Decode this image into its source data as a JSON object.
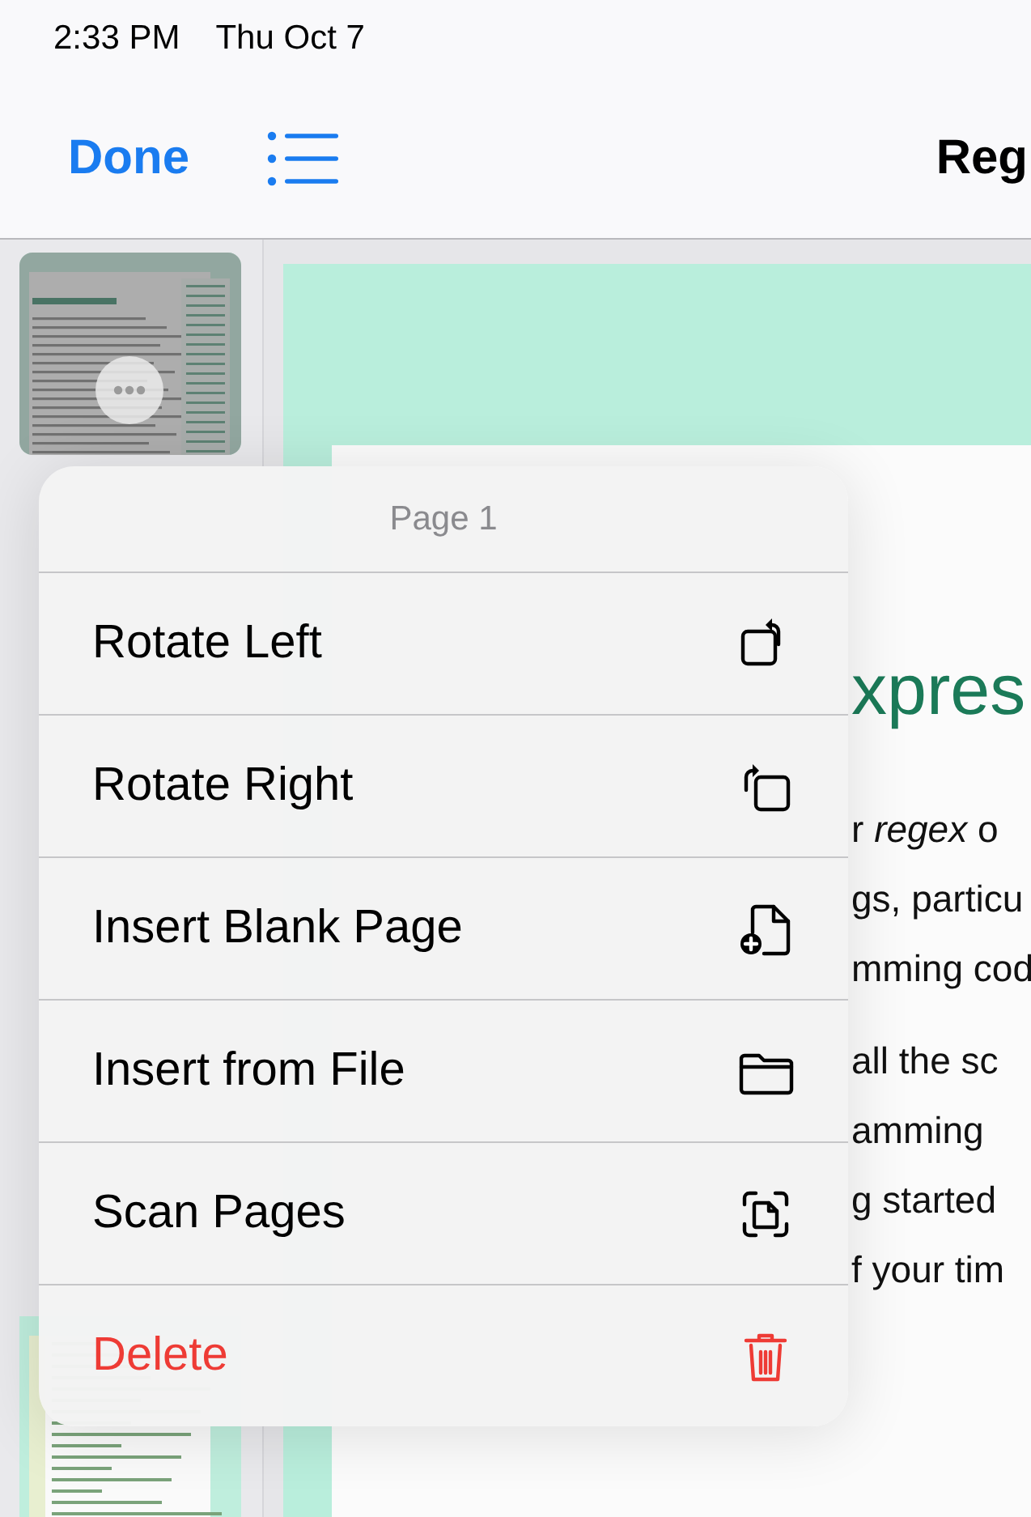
{
  "status_bar": {
    "time": "2:33 PM",
    "date": "Thu Oct 7"
  },
  "nav_bar": {
    "done_button": "Done",
    "title": "Reg"
  },
  "thumbnails": [
    {
      "kind": "text",
      "selected": true
    },
    {
      "kind": "code",
      "selected": false
    }
  ],
  "document": {
    "heading": "xpres",
    "paragraphs": [
      [
        "r *regex* o",
        "gs, particu",
        "mming cod"
      ],
      [
        "all the sc",
        "amming",
        "g started",
        "f your tim"
      ]
    ]
  },
  "context_menu": {
    "title": "Page 1",
    "items": [
      {
        "label": "Rotate Left",
        "kind": "rotate-left",
        "destructive": false
      },
      {
        "label": "Rotate Right",
        "kind": "rotate-right",
        "destructive": false
      },
      {
        "label": "Insert Blank Page",
        "kind": "blank-page",
        "destructive": false
      },
      {
        "label": "Insert from File",
        "kind": "folder",
        "destructive": false
      },
      {
        "label": "Scan Pages",
        "kind": "scan",
        "destructive": false
      },
      {
        "label": "Delete",
        "kind": "trash",
        "destructive": true
      }
    ]
  }
}
